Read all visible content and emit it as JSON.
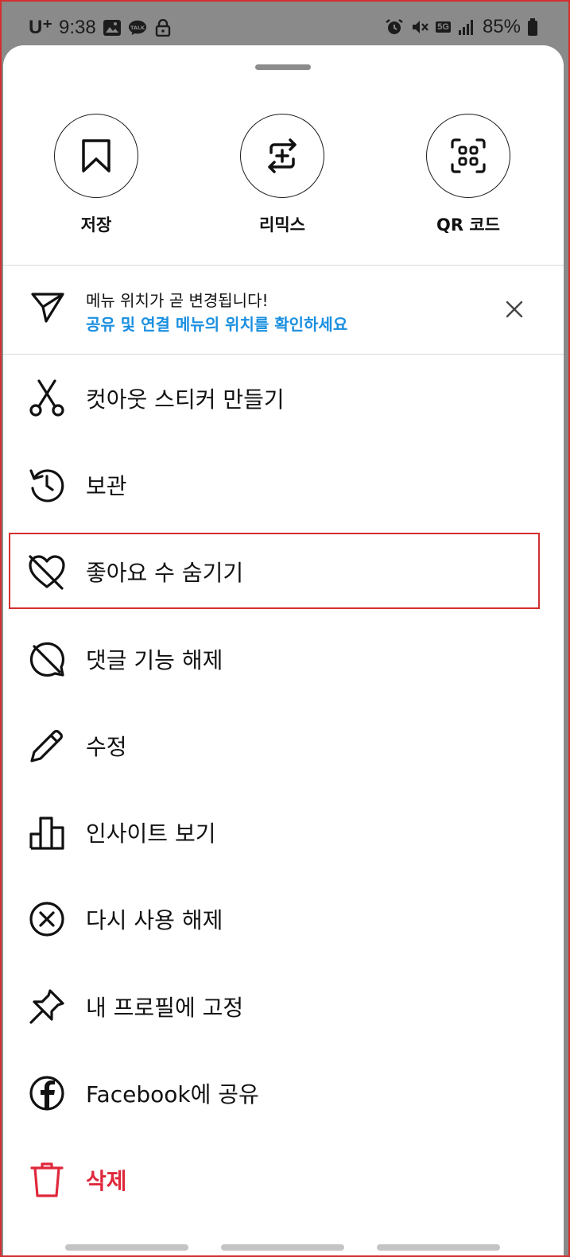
{
  "status_bar": {
    "carrier": "U⁺",
    "time": "9:38",
    "battery": "85%",
    "network": "5G"
  },
  "actions": [
    {
      "label": "저장",
      "icon": "bookmark-icon"
    },
    {
      "label": "리믹스",
      "icon": "remix-icon"
    },
    {
      "label": "QR 코드",
      "icon": "qr-code-icon"
    }
  ],
  "notice": {
    "title": "메뉴 위치가 곧 변경됩니다!",
    "link": "공유 및 연결 메뉴의 위치를 확인하세요"
  },
  "menu": [
    {
      "label": "컷아웃 스티커 만들기",
      "icon": "scissors-icon"
    },
    {
      "label": "보관",
      "icon": "archive-history-icon"
    },
    {
      "label": "좋아요 수 숨기기",
      "icon": "heart-off-icon"
    },
    {
      "label": "댓글 기능 해제",
      "icon": "comment-off-icon"
    },
    {
      "label": "수정",
      "icon": "pencil-icon"
    },
    {
      "label": "인사이트 보기",
      "icon": "insights-icon"
    },
    {
      "label": "다시 사용 해제",
      "icon": "remove-circle-icon"
    },
    {
      "label": "내 프로필에 고정",
      "icon": "pin-icon"
    },
    {
      "label": "Facebook에 공유",
      "icon": "facebook-icon"
    },
    {
      "label": "삭제",
      "icon": "trash-icon"
    }
  ],
  "colors": {
    "link": "#1a8fe0",
    "danger": "#e0283b",
    "highlight": "#d32f2f"
  }
}
